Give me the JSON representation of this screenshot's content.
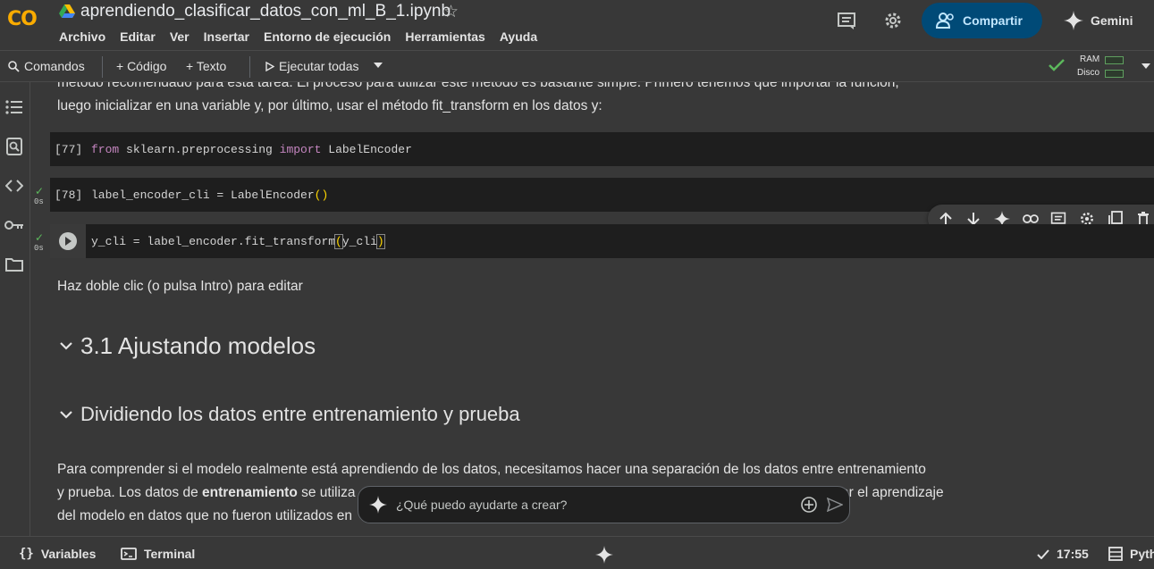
{
  "header": {
    "logo": "CO",
    "notebook_title": "aprendiendo_clasificar_datos_con_ml_B_1.ipynb",
    "star": "☆",
    "menu": [
      "Archivo",
      "Editar",
      "Ver",
      "Insertar",
      "Entorno de ejecución",
      "Herramientas",
      "Ayuda"
    ],
    "share_label": "Compartir",
    "gemini_label": "Gemini"
  },
  "toolbar": {
    "commands_label": "Comandos",
    "code_label": "+ Código",
    "text_label": "+ Texto",
    "run_all_label": "Ejecutar todas",
    "ram_label": "RAM",
    "disk_label": "Disco"
  },
  "content": {
    "para_top_line1": "método recomendado para esta tarea. El proceso para utilizar este método es bastante simple. Primero tenemos que importar la función,",
    "para_top_line2": "luego inicializar en una variable y, por último, usar el método fit_transform en los datos y:",
    "cells": [
      {
        "count": "[77]",
        "kw1": "from",
        "mod": " sklearn.preprocessing ",
        "kw2": "import",
        "rest": " LabelEncoder"
      },
      {
        "count": "[78]",
        "code": "label_encoder_cli = LabelEncoder",
        "paren": "()",
        "time": "0s"
      },
      {
        "code_pre": "y_cli = label_encoder.fit_transform",
        "paren_open": "(",
        "arg": "y_cli",
        "paren_close": ")",
        "time": "0s"
      }
    ],
    "edit_hint": "Haz doble clic (o pulsa Intro) para editar",
    "heading1": "3.1 Ajustando modelos",
    "heading2": "Dividiendo los datos entre entrenamiento y prueba",
    "para_bottom_line1": "Para comprender si el modelo realmente está aprendiendo de los datos, necesitamos hacer una separación de los datos entre entrenamiento",
    "para_bottom_line2_a": "y prueba. Los datos de ",
    "para_bottom_line2_b": "entrenamiento",
    "para_bottom_line2_c": " se utiliza",
    "para_bottom_line2_d": "ar el aprendizaje",
    "para_bottom_line3": "del modelo en datos que no fueron utilizados en"
  },
  "prompt": {
    "placeholder": "¿Qué puedo ayudarte a crear?"
  },
  "statusbar": {
    "variables_label": "Variables",
    "terminal_label": "Terminal",
    "time": "17:55",
    "runtime_label": "Pyth"
  },
  "colors": {
    "accent_share_bg": "#004a77",
    "accent_share_text": "#c2e7ff",
    "logo": "#f9ab00",
    "success": "#5cb85c"
  }
}
